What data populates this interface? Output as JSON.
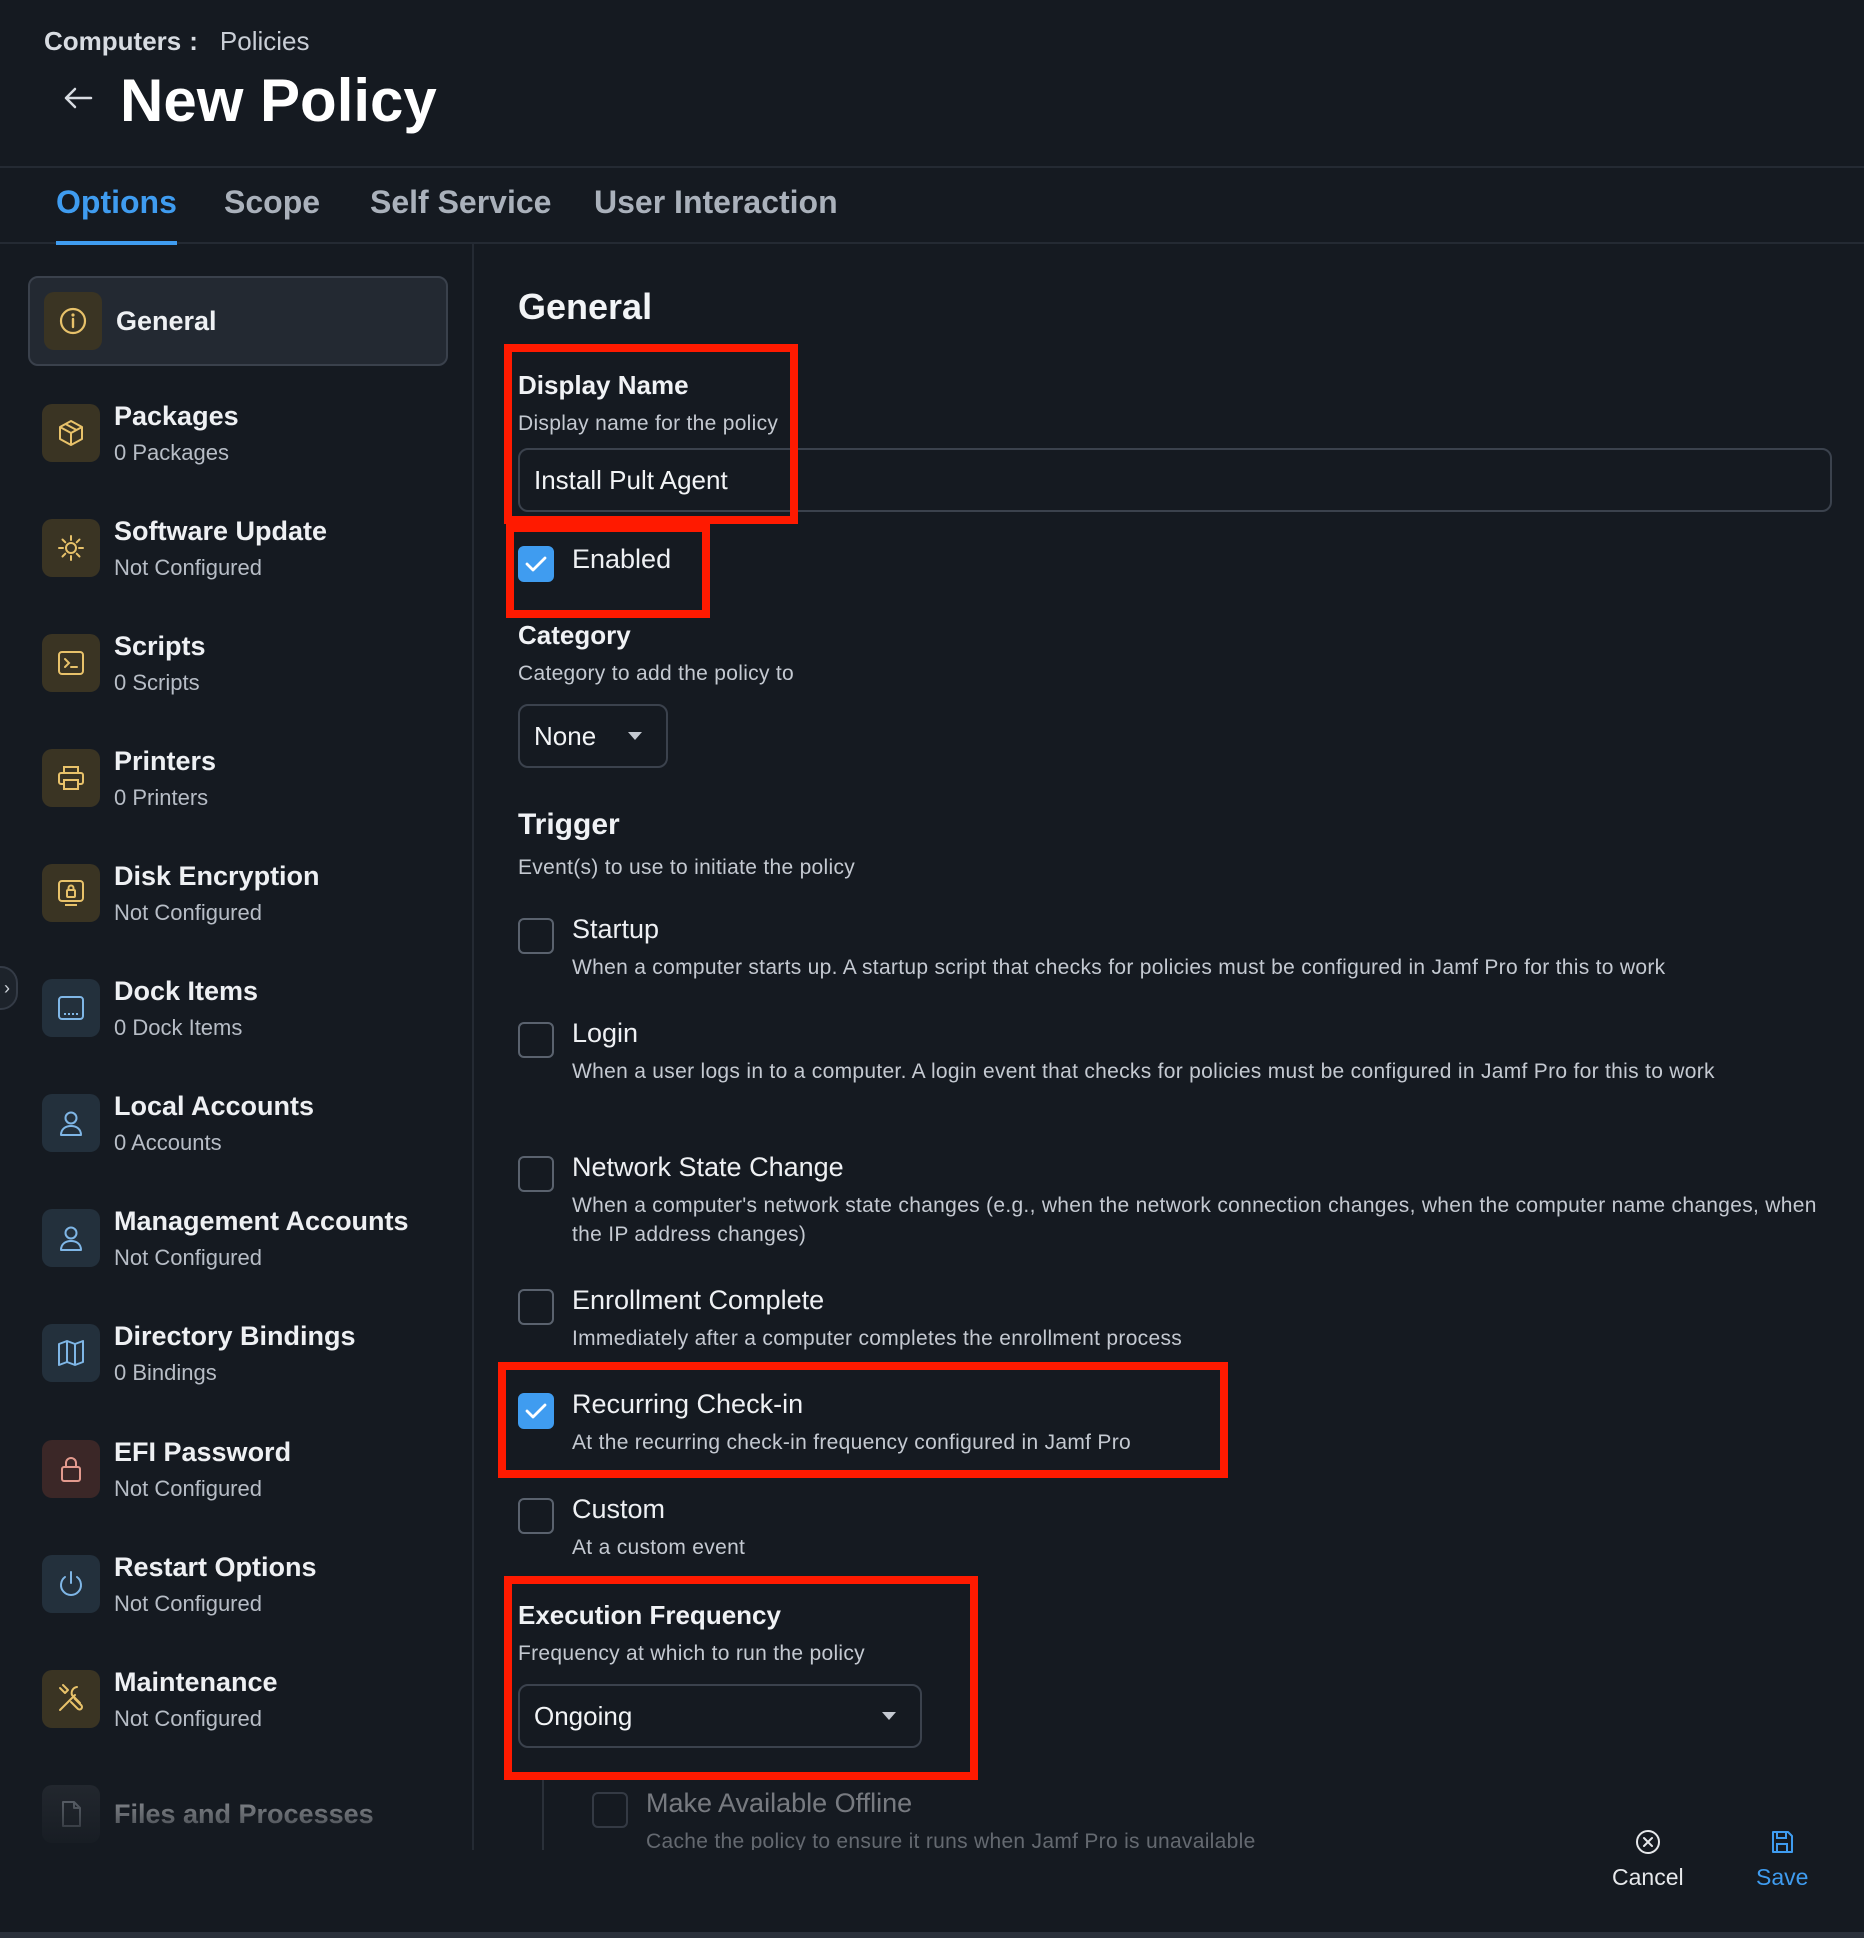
{
  "breadcrumb": {
    "root": "Computers",
    "separator": ":",
    "current": "Policies"
  },
  "page_title": "New Policy",
  "tabs": [
    {
      "label": "Options",
      "active": true
    },
    {
      "label": "Scope",
      "active": false
    },
    {
      "label": "Self Service",
      "active": false
    },
    {
      "label": "User Interaction",
      "active": false
    }
  ],
  "sidebar": {
    "items": [
      {
        "title": "General",
        "subtitle": "",
        "icon": "info-icon",
        "active": true
      },
      {
        "title": "Packages",
        "subtitle": "0 Packages",
        "icon": "package-icon"
      },
      {
        "title": "Software Update",
        "subtitle": "Not Configured",
        "icon": "update-gear-icon"
      },
      {
        "title": "Scripts",
        "subtitle": "0 Scripts",
        "icon": "terminal-icon"
      },
      {
        "title": "Printers",
        "subtitle": "0 Printers",
        "icon": "printer-icon"
      },
      {
        "title": "Disk Encryption",
        "subtitle": "Not Configured",
        "icon": "disk-lock-icon"
      },
      {
        "title": "Dock Items",
        "subtitle": "0 Dock Items",
        "icon": "dock-icon"
      },
      {
        "title": "Local Accounts",
        "subtitle": "0 Accounts",
        "icon": "user-icon"
      },
      {
        "title": "Management Accounts",
        "subtitle": "Not Configured",
        "icon": "user-icon"
      },
      {
        "title": "Directory Bindings",
        "subtitle": "0 Bindings",
        "icon": "map-icon"
      },
      {
        "title": "EFI Password",
        "subtitle": "Not Configured",
        "icon": "lock-icon"
      },
      {
        "title": "Restart Options",
        "subtitle": "Not Configured",
        "icon": "power-icon"
      },
      {
        "title": "Maintenance",
        "subtitle": "Not Configured",
        "icon": "tools-icon"
      },
      {
        "title": "Files and Processes",
        "subtitle": "",
        "icon": "file-icon"
      }
    ]
  },
  "general": {
    "section_title": "General",
    "display_name": {
      "label": "Display Name",
      "description": "Display name for the policy",
      "value": "Install Pult Agent"
    },
    "enabled": {
      "label": "Enabled",
      "checked": true
    },
    "category": {
      "label": "Category",
      "description": "Category to add the policy to",
      "selected": "None"
    },
    "trigger": {
      "label": "Trigger",
      "description": "Event(s) to use to initiate the policy",
      "options": [
        {
          "title": "Startup",
          "description": "When a computer starts up. A startup script that checks for policies must be configured in Jamf Pro for this to work",
          "checked": false
        },
        {
          "title": "Login",
          "description": "When a user logs in to a computer. A login event that checks for policies must be configured in Jamf Pro for this to work",
          "checked": false
        },
        {
          "title": "Network State Change",
          "description": "When a computer's network state changes (e.g., when the network connection changes, when the computer name changes, when the IP address changes)",
          "checked": false
        },
        {
          "title": "Enrollment Complete",
          "description": "Immediately after a computer completes the enrollment process",
          "checked": false
        },
        {
          "title": "Recurring Check-in",
          "description": "At the recurring check-in frequency configured in Jamf Pro",
          "checked": true
        },
        {
          "title": "Custom",
          "description": "At a custom event",
          "checked": false
        }
      ]
    },
    "execution_frequency": {
      "label": "Execution Frequency",
      "description": "Frequency at which to run the policy",
      "selected": "Ongoing"
    },
    "make_available_offline": {
      "title": "Make Available Offline",
      "description": "Cache the policy to ensure it runs when Jamf Pro is unavailable",
      "checked": false
    }
  },
  "footer": {
    "cancel_label": "Cancel",
    "save_label": "Save"
  },
  "colors": {
    "accent": "#3f9cf0",
    "highlight": "#ff1a00",
    "background": "#151a21"
  }
}
